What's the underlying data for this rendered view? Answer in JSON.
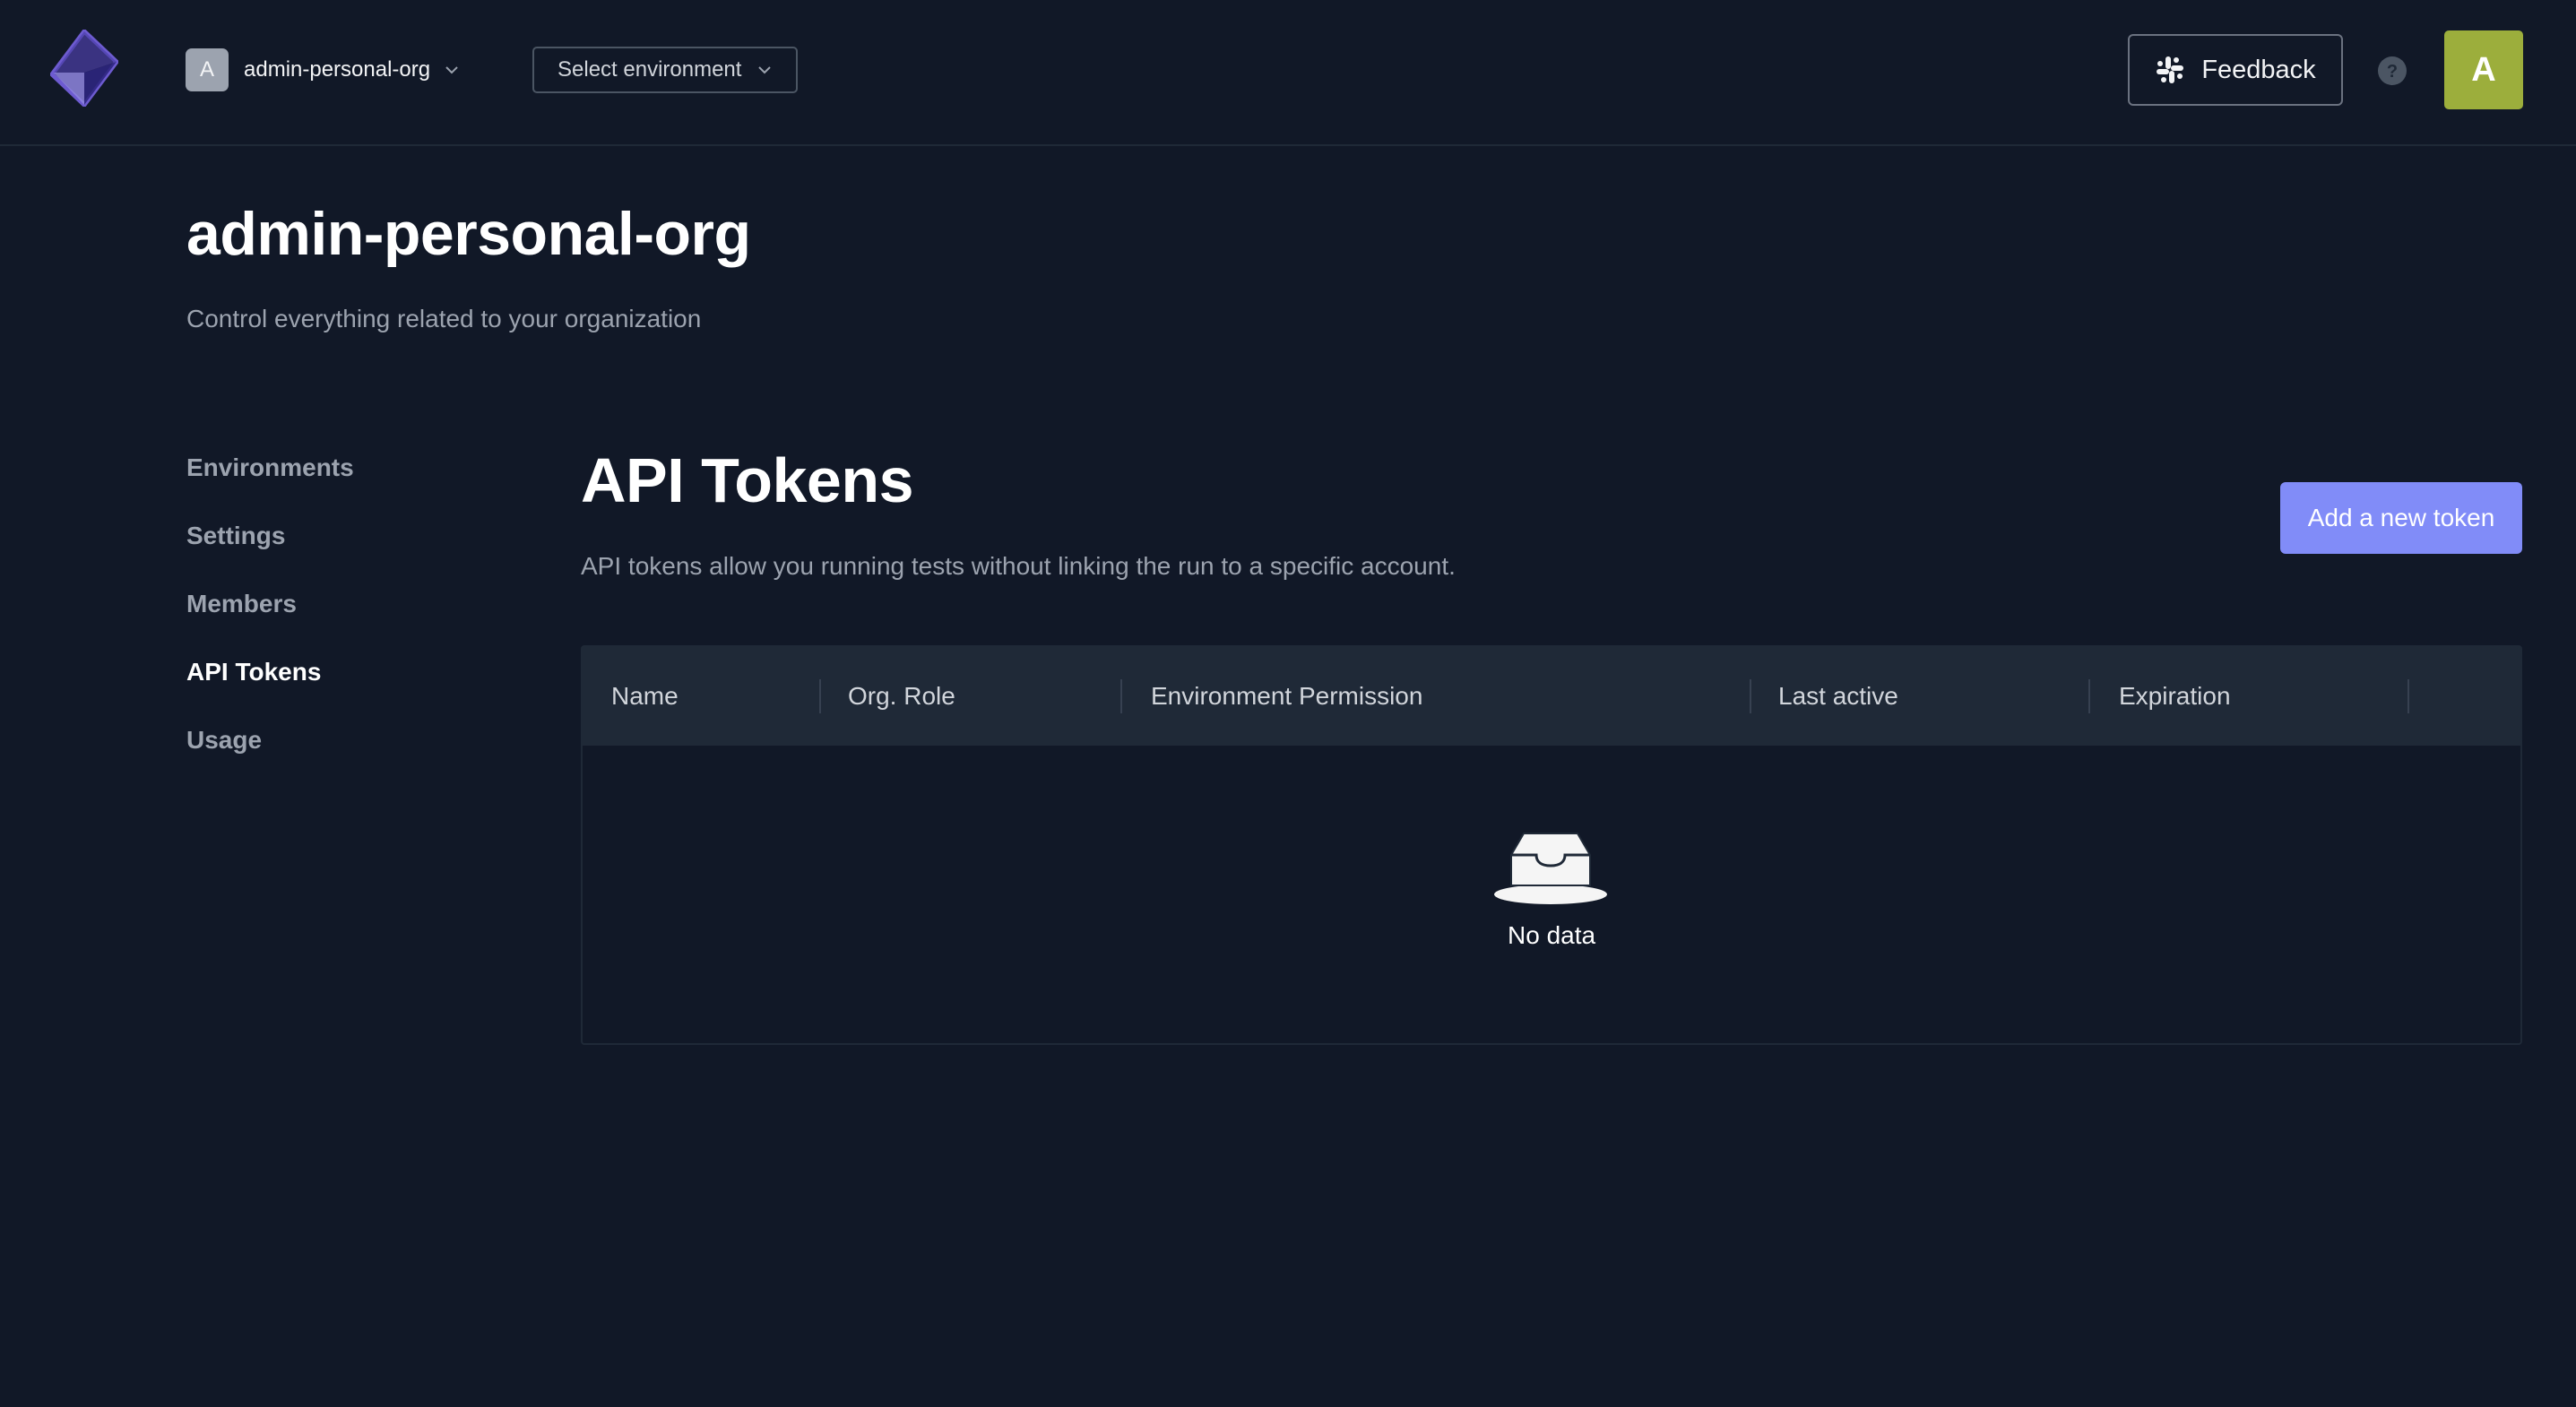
{
  "header": {
    "org_avatar_letter": "A",
    "org_name": "admin-personal-org",
    "env_select_label": "Select environment",
    "feedback_label": "Feedback",
    "user_avatar_letter": "A",
    "user_avatar_color": "#9cae3c"
  },
  "page": {
    "title": "admin-personal-org",
    "subtitle": "Control everything related to your organization"
  },
  "sidenav": {
    "items": [
      {
        "label": "Environments",
        "active": false
      },
      {
        "label": "Settings",
        "active": false
      },
      {
        "label": "Members",
        "active": false
      },
      {
        "label": "API Tokens",
        "active": true
      },
      {
        "label": "Usage",
        "active": false
      }
    ]
  },
  "section": {
    "title": "API Tokens",
    "subtitle": "API tokens allow you running tests without linking the run to a specific account.",
    "add_button_label": "Add a new token",
    "accent_color": "#818cf8"
  },
  "table": {
    "columns": [
      "Name",
      "Org. Role",
      "Environment Permission",
      "Last active",
      "Expiration"
    ],
    "empty_text": "No data"
  },
  "icons": [
    "logo-icon",
    "chevron-down-icon",
    "slack-icon",
    "help-icon",
    "empty-inbox-icon"
  ]
}
